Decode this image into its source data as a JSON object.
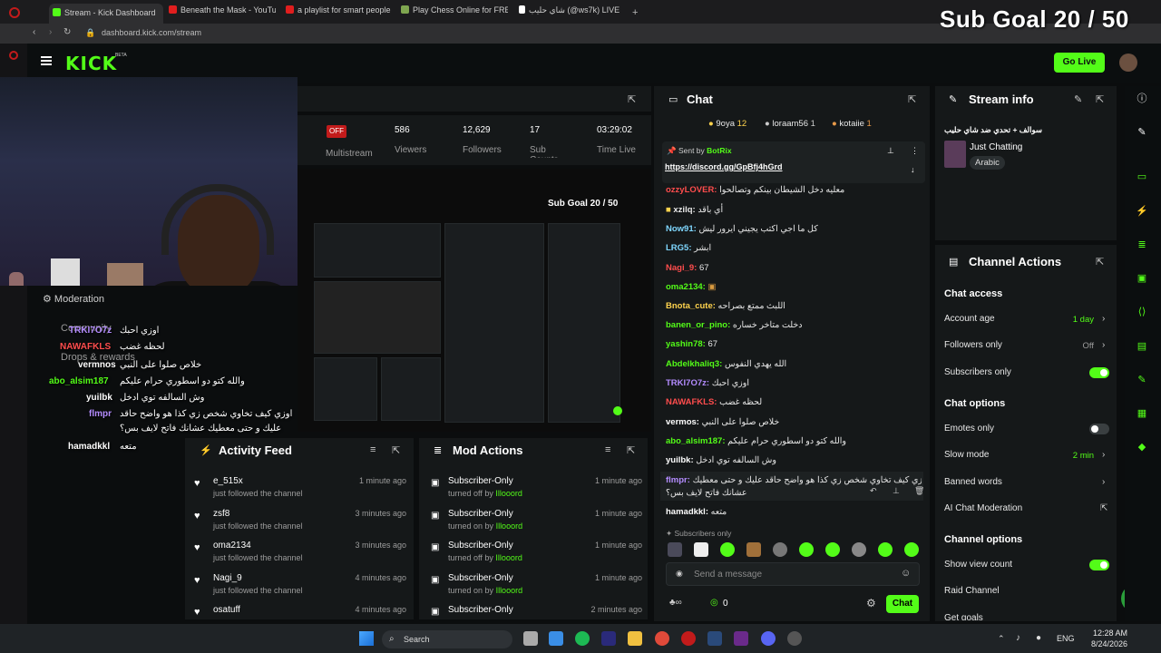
{
  "browser": {
    "tabs": [
      {
        "label": "Stream - Kick Dashboard",
        "color": "#53fc18"
      },
      {
        "label": "Beneath the Mask - YouTube",
        "color": "#e01e1e"
      },
      {
        "label": "a playlist for smart people",
        "color": "#e01e1e"
      },
      {
        "label": "Play Chess Online for FREE",
        "color": "#7fa650"
      },
      {
        "label": "شاي حليب (@ws7k) LIVE",
        "color": "#ffffff"
      }
    ],
    "url": "dashboard.kick.com/stream"
  },
  "kick": {
    "logo": "KICK",
    "beta": "BETA",
    "go_live": "Go Live",
    "overlay_goal": "Sub Goal 20 / 50"
  },
  "stats": {
    "status": "OFF",
    "multistream": "Multistream",
    "viewers_value": "586",
    "viewers_label": "Viewers",
    "followers_value": "12,629",
    "followers_label": "Followers",
    "subs_value": "17",
    "subs_label": "Sub Counts",
    "time_value": "03:29:02",
    "time_label": "Time Live"
  },
  "preview": {
    "goal": "Sub Goal 20 / 50"
  },
  "left_nav": {
    "moderation": "Moderation",
    "community": "Community",
    "drops": "Drops & rewards"
  },
  "overlay_chat": [
    {
      "name": "TRKI7O7z",
      "msg": "اوزي احبك",
      "color": "#b48cff"
    },
    {
      "name": "NAWAFKLS",
      "msg": "لحظه غضب",
      "color": "#ff4d4d"
    },
    {
      "name": "vermnos",
      "msg": "خلاص صلوا على النبي",
      "color": "#ffffff"
    },
    {
      "name": "abo_alsim187",
      "msg": "والله كتو دو اسطوري حرام عليكم",
      "color": "#53fc18"
    },
    {
      "name": "yuilbk",
      "msg": "وش السالفه توي ادخل",
      "color": "#ffffff"
    },
    {
      "name": "flmpr",
      "msg": "اوزي كيف تخاوي شخص زي كذا هو واضح حاقد",
      "color": "#b48cff"
    },
    {
      "name": "",
      "msg": "عليك و حتى معطيك عشانك فاتح لايف بس؟",
      "color": "#ffffff"
    },
    {
      "name": "hamadkkl",
      "msg": "متعه",
      "color": "#ffffff"
    }
  ],
  "activity": {
    "title": "Activity Feed",
    "items": [
      {
        "name": "e_515x",
        "sub": "just followed the channel",
        "time": "1 minute ago"
      },
      {
        "name": "zsf8",
        "sub": "just followed the channel",
        "time": "3 minutes ago"
      },
      {
        "name": "oma2134",
        "sub": "just followed the channel",
        "time": "3 minutes ago"
      },
      {
        "name": "Nagi_9",
        "sub": "just followed the channel",
        "time": "4 minutes ago"
      },
      {
        "name": "osatuff",
        "sub": "",
        "time": "4 minutes ago"
      }
    ]
  },
  "mod_actions": {
    "title": "Mod Actions",
    "items": [
      {
        "title": "Subscriber-Only",
        "by": "turned off by",
        "user": "Illooord",
        "time": "1 minute ago"
      },
      {
        "title": "Subscriber-Only",
        "by": "turned on by",
        "user": "Illooord",
        "time": "1 minute ago"
      },
      {
        "title": "Subscriber-Only",
        "by": "turned off by",
        "user": "Illooord",
        "time": "1 minute ago"
      },
      {
        "title": "Subscriber-Only",
        "by": "turned on by",
        "user": "Illooord",
        "time": "1 minute ago"
      },
      {
        "title": "Subscriber-Only",
        "by": "",
        "user": "",
        "time": "2 minutes ago"
      }
    ]
  },
  "chat": {
    "title": "Chat",
    "top_supporters": [
      {
        "name": "9oya",
        "count": "12"
      },
      {
        "name": "loraam56",
        "count": "1"
      },
      {
        "name": "kotaiie",
        "count": "1"
      }
    ],
    "pinned_sender_label": "Sent by",
    "pinned_sender": "BotRix",
    "pinned_link": "https://discord.gg/GpBfj4hGrd",
    "messages": [
      {
        "name": "ozzyLOVER:",
        "text": "معليه دخل الشيطان بينكم وتصالحوا",
        "color": "#ff4d4d"
      },
      {
        "name": "xzilq:",
        "text": "أي باقد",
        "color": "#e8e8e8"
      },
      {
        "name": "Now91:",
        "text": "كل ما اجي اكتب يجيني ايرور ليش",
        "color": "#7fd7ff"
      },
      {
        "name": "LRG5:",
        "text": "ابشر",
        "color": "#7fd7ff"
      },
      {
        "name": "Nagi_9:",
        "text": "67",
        "color": "#ff4d4d"
      },
      {
        "name": "oma2134:",
        "text": "",
        "color": "#53fc18"
      },
      {
        "name": "Bnota_cute:",
        "text": "اللبث ممتع بصراحه",
        "color": "#ffd34d"
      },
      {
        "name": "banen_or_pino:",
        "text": "دخلت متاخر خساره",
        "color": "#53fc18"
      },
      {
        "name": "yashin78:",
        "text": "67",
        "color": "#53fc18"
      },
      {
        "name": "Abdelkhaliq3:",
        "text": "الله يهدي النفوس",
        "color": "#53fc18"
      },
      {
        "name": "TRKI7O7z:",
        "text": "اوزي احبك",
        "color": "#b48cff"
      },
      {
        "name": "NAWAFKLS:",
        "text": "لحظه غضب",
        "color": "#ff4d4d"
      },
      {
        "name": "vermos:",
        "text": "خلاص صلوا على النبي",
        "color": "#ffffff"
      },
      {
        "name": "abo_alsim187:",
        "text": "والله كتو دو اسطوري حرام عليكم",
        "color": "#53fc18"
      },
      {
        "name": "yuilbk:",
        "text": "وش السالفه توي ادخل",
        "color": "#ffffff"
      },
      {
        "name": "flmpr:",
        "text": "اوزي كيف تخاوي شخص زي كذا هو واضح حاقد عليك و حتى معطيك",
        "color": "#b48cff"
      },
      {
        "name": "",
        "text": "عشانك فاتح لايف بس؟",
        "color": "#e8e8e8"
      },
      {
        "name": "hamadkkl:",
        "text": "متعه",
        "color": "#ffffff"
      }
    ],
    "subscribers_only": "Subscribers only",
    "input_placeholder": "Send a message",
    "points": "0",
    "send_label": "Chat"
  },
  "stream_info": {
    "title": "Stream info",
    "stream_title": "سوالف + تحدي ضد شاي حليب",
    "category": "Just Chatting",
    "tag": "Arabic"
  },
  "channel_actions": {
    "title": "Channel Actions",
    "chat_access": "Chat access",
    "account_age": "Account age",
    "account_age_val": "1 day",
    "followers_only": "Followers only",
    "followers_only_val": "Off",
    "subscribers_only": "Subscribers only",
    "chat_options": "Chat options",
    "emotes_only": "Emotes only",
    "slow_mode": "Slow mode",
    "slow_mode_val": "2 min",
    "banned_words": "Banned words",
    "ai_mod": "AI Chat Moderation",
    "channel_options": "Channel options",
    "show_view_count": "Show view count",
    "raid_channel": "Raid Channel",
    "cut_off": "Get goals"
  },
  "taskbar": {
    "search": "Search",
    "lang": "ENG",
    "time": "12:28 AM",
    "date": "8/24/2026"
  }
}
